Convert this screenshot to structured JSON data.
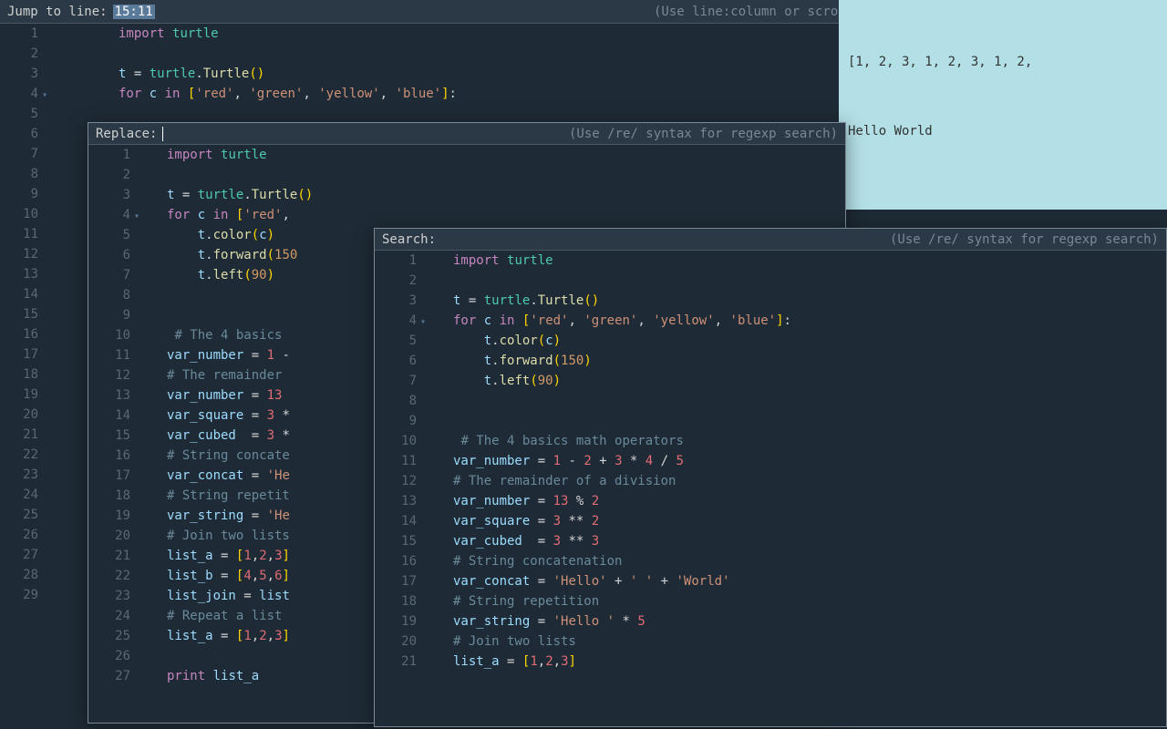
{
  "topbar": {
    "label": "Jump to line:",
    "value": "15:11",
    "hint": "(Use line:column or scroll% syntax)"
  },
  "output": {
    "line1": "[1, 2, 3, 1, 2, 3, 1, 2,",
    "line2": "Hello World"
  },
  "main": {
    "gutter": [
      "1",
      "2",
      "3",
      "4",
      "5",
      "6",
      "7",
      "8",
      "9",
      "10",
      "11",
      "12",
      "13",
      "14",
      "15",
      "16",
      "17",
      "18",
      "19",
      "20",
      "21",
      "22",
      "23",
      "24",
      "25",
      "26",
      "27",
      "28",
      "29"
    ],
    "fold_index": 3
  },
  "code": {
    "import_kw": "import",
    "turtle_mod": "turtle",
    "t_assign_t": "t",
    "eq": " = ",
    "turtle_call": "turtle",
    "dot": ".",
    "Turtle": "Turtle",
    "lp": "(",
    "rp": ")",
    "for_kw": "for",
    "c_var": "c",
    "in_kw": "in",
    "list_red": "'red'",
    "comma": ", ",
    "list_green": "'green'",
    "list_yellow": "'yellow'",
    "list_blue": "'blue'",
    "colon": ":",
    "indent4": "    ",
    "indent8": "        ",
    "t_var": "t",
    "color_fn": "color",
    "forward_fn": "forward",
    "left_fn": "left",
    "n150": "150",
    "n90": "90",
    "cmt_basics4": "# The 4 basics ",
    "cmt_basics_full": "# The 4 basics math operators",
    "var_number": "var_number",
    "var_square": "var_square",
    "var_cubed": "var_cubed",
    "var_concat": "var_concat",
    "var_string": "var_string",
    "list_a": "list_a",
    "list_b": "list_b",
    "list_join": "list_join",
    "n1": "1",
    "n2": "2",
    "n3": "3",
    "n4": "4",
    "n5": "5",
    "n13": "13",
    "minus": " - ",
    "plus": " + ",
    "mul": " * ",
    "div": " / ",
    "mod": " % ",
    "pow": " ** ",
    "cmt_remainder_short": "# The remainder",
    "cmt_remainder_full": "# The remainder of a division",
    "cmt_concat_short": "# String concate",
    "cmt_concat_full": "# String concatenation",
    "cmt_repet_short": "# String repetit",
    "cmt_repet_full": "# String repetition",
    "cmt_join": "# Join two lists",
    "cmt_repeat_list": "# Repeat a list",
    "hello_str": "'Hello'",
    "space_str": "' '",
    "world_str": "'World'",
    "hello_sp_str": "'Hello '",
    "He_str": "'He",
    "lbrack": "[",
    "rbrack": "]",
    "list123": "[1,2,3]",
    "list456": "[4,5,6]",
    "list_word": "list",
    "print_kw": "print",
    "n6": "6"
  },
  "replace": {
    "label": "Replace:",
    "hint": "(Use /re/ syntax for regexp search)",
    "gutter": [
      "1",
      "2",
      "3",
      "4",
      "5",
      "6",
      "7",
      "8",
      "9",
      "10",
      "11",
      "12",
      "13",
      "14",
      "15",
      "16",
      "17",
      "18",
      "19",
      "20",
      "21",
      "22",
      "23",
      "24",
      "25",
      "26",
      "27"
    ],
    "fold_index": 3
  },
  "search": {
    "label": "Search:",
    "hint": "(Use /re/ syntax for regexp search)",
    "gutter": [
      "1",
      "2",
      "3",
      "4",
      "5",
      "6",
      "7",
      "8",
      "9",
      "10",
      "11",
      "12",
      "13",
      "14",
      "15",
      "16",
      "17",
      "18",
      "19",
      "20",
      "21"
    ],
    "fold_index": 3
  }
}
